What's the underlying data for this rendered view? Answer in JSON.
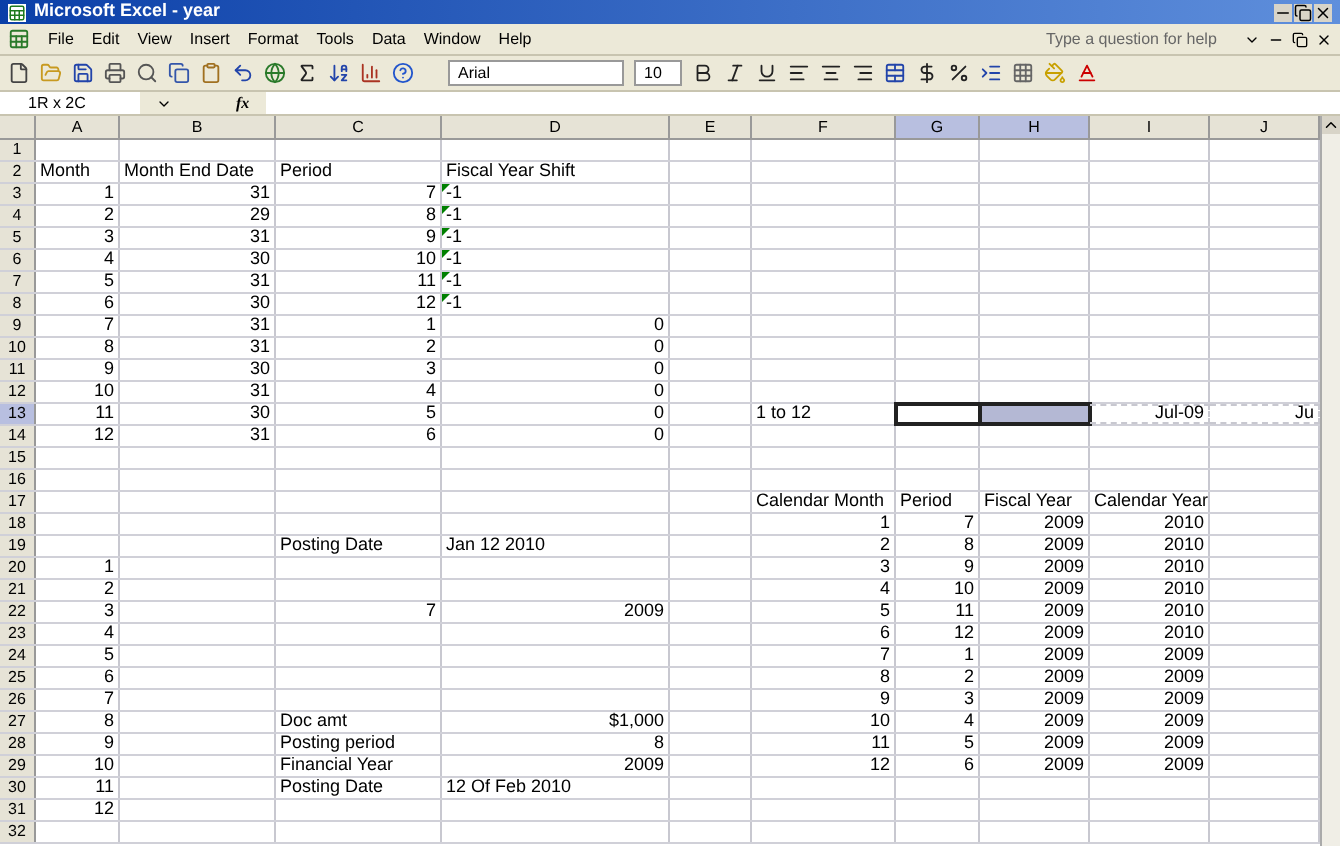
{
  "window": {
    "title": "Microsoft Excel - year"
  },
  "menu": [
    "File",
    "Edit",
    "View",
    "Insert",
    "Format",
    "Tools",
    "Data",
    "Window",
    "Help"
  ],
  "help_box": {
    "placeholder": "Type a question for help"
  },
  "font": {
    "name": "Arial",
    "size": "10"
  },
  "name_box": "1R x 2C",
  "function_label": "fx",
  "columns": [
    {
      "label": "A",
      "selected": false
    },
    {
      "label": "B",
      "selected": false
    },
    {
      "label": "C",
      "selected": false
    },
    {
      "label": "D",
      "selected": false
    },
    {
      "label": "E",
      "selected": false
    },
    {
      "label": "F",
      "selected": false
    },
    {
      "label": "G",
      "selected": true
    },
    {
      "label": "H",
      "selected": true
    },
    {
      "label": "I",
      "selected": false
    },
    {
      "label": "J",
      "selected": false
    }
  ],
  "rows": [
    {
      "number": "1",
      "selected": false,
      "cells": {}
    },
    {
      "number": "2",
      "selected": false,
      "cells": {
        "A": {
          "text": "Month",
          "kind": "text"
        },
        "B": {
          "text": "Month End Date",
          "kind": "text"
        },
        "C": {
          "text": "Period",
          "kind": "text"
        },
        "D": {
          "text": "Fiscal Year Shift",
          "kind": "text"
        }
      }
    },
    {
      "number": "3",
      "selected": false,
      "cells": {
        "A": {
          "text": "1",
          "kind": "number"
        },
        "B": {
          "text": "31",
          "kind": "number"
        },
        "C": {
          "text": "7",
          "kind": "number"
        },
        "D": {
          "text": "-1",
          "kind": "text",
          "flag": true
        }
      }
    },
    {
      "number": "4",
      "selected": false,
      "cells": {
        "A": {
          "text": "2",
          "kind": "number"
        },
        "B": {
          "text": "29",
          "kind": "number"
        },
        "C": {
          "text": "8",
          "kind": "number"
        },
        "D": {
          "text": "-1",
          "kind": "text",
          "flag": true
        }
      }
    },
    {
      "number": "5",
      "selected": false,
      "cells": {
        "A": {
          "text": "3",
          "kind": "number"
        },
        "B": {
          "text": "31",
          "kind": "number"
        },
        "C": {
          "text": "9",
          "kind": "number"
        },
        "D": {
          "text": "-1",
          "kind": "text",
          "flag": true
        }
      }
    },
    {
      "number": "6",
      "selected": false,
      "cells": {
        "A": {
          "text": "4",
          "kind": "number"
        },
        "B": {
          "text": "30",
          "kind": "number"
        },
        "C": {
          "text": "10",
          "kind": "number"
        },
        "D": {
          "text": "-1",
          "kind": "text",
          "flag": true
        }
      }
    },
    {
      "number": "7",
      "selected": false,
      "cells": {
        "A": {
          "text": "5",
          "kind": "number"
        },
        "B": {
          "text": "31",
          "kind": "number"
        },
        "C": {
          "text": "11",
          "kind": "number"
        },
        "D": {
          "text": "-1",
          "kind": "text",
          "flag": true
        }
      }
    },
    {
      "number": "8",
      "selected": false,
      "cells": {
        "A": {
          "text": "6",
          "kind": "number"
        },
        "B": {
          "text": "30",
          "kind": "number"
        },
        "C": {
          "text": "12",
          "kind": "number"
        },
        "D": {
          "text": "-1",
          "kind": "text",
          "flag": true
        }
      }
    },
    {
      "number": "9",
      "selected": false,
      "cells": {
        "A": {
          "text": "7",
          "kind": "number"
        },
        "B": {
          "text": "31",
          "kind": "number"
        },
        "C": {
          "text": "1",
          "kind": "number"
        },
        "D": {
          "text": "0",
          "kind": "number"
        }
      }
    },
    {
      "number": "10",
      "selected": false,
      "cells": {
        "A": {
          "text": "8",
          "kind": "number"
        },
        "B": {
          "text": "31",
          "kind": "number"
        },
        "C": {
          "text": "2",
          "kind": "number"
        },
        "D": {
          "text": "0",
          "kind": "number"
        }
      }
    },
    {
      "number": "11",
      "selected": false,
      "cells": {
        "A": {
          "text": "9",
          "kind": "number"
        },
        "B": {
          "text": "30",
          "kind": "number"
        },
        "C": {
          "text": "3",
          "kind": "number"
        },
        "D": {
          "text": "0",
          "kind": "number"
        }
      }
    },
    {
      "number": "12",
      "selected": false,
      "cells": {
        "A": {
          "text": "10",
          "kind": "number"
        },
        "B": {
          "text": "31",
          "kind": "number"
        },
        "C": {
          "text": "4",
          "kind": "number"
        },
        "D": {
          "text": "0",
          "kind": "number"
        }
      }
    },
    {
      "number": "13",
      "selected": true,
      "cells": {
        "A": {
          "text": "11",
          "kind": "number"
        },
        "B": {
          "text": "30",
          "kind": "number"
        },
        "C": {
          "text": "5",
          "kind": "number"
        },
        "D": {
          "text": "0",
          "kind": "number"
        },
        "F": {
          "text": "1 to 12",
          "kind": "text"
        },
        "G": {
          "active": true
        },
        "H": {
          "in_selection": true
        },
        "I": {
          "text": "Jul-09",
          "kind": "number",
          "copy_marquee": true
        },
        "J": {
          "text": "Ju",
          "kind": "number",
          "copy_marquee": true
        }
      }
    },
    {
      "number": "14",
      "selected": false,
      "cells": {
        "A": {
          "text": "12",
          "kind": "number"
        },
        "B": {
          "text": "31",
          "kind": "number"
        },
        "C": {
          "text": "6",
          "kind": "number"
        },
        "D": {
          "text": "0",
          "kind": "number"
        }
      }
    },
    {
      "number": "15",
      "selected": false,
      "cells": {}
    },
    {
      "number": "16",
      "selected": false,
      "cells": {}
    },
    {
      "number": "17",
      "selected": false,
      "cells": {
        "F": {
          "text": "Calendar Month",
          "kind": "text"
        },
        "G": {
          "text": "Period",
          "kind": "text"
        },
        "H": {
          "text": "Fiscal Year",
          "kind": "text"
        },
        "I": {
          "text": "Calendar Year",
          "kind": "text"
        }
      }
    },
    {
      "number": "18",
      "selected": false,
      "cells": {
        "F": {
          "text": "1",
          "kind": "number"
        },
        "G": {
          "text": "7",
          "kind": "number"
        },
        "H": {
          "text": "2009",
          "kind": "number"
        },
        "I": {
          "text": "2010",
          "kind": "number"
        }
      }
    },
    {
      "number": "19",
      "selected": false,
      "cells": {
        "C": {
          "text": "Posting Date",
          "kind": "text"
        },
        "D": {
          "text": "Jan 12 2010",
          "kind": "text"
        },
        "F": {
          "text": "2",
          "kind": "number"
        },
        "G": {
          "text": "8",
          "kind": "number"
        },
        "H": {
          "text": "2009",
          "kind": "number"
        },
        "I": {
          "text": "2010",
          "kind": "number"
        }
      }
    },
    {
      "number": "20",
      "selected": false,
      "cells": {
        "A": {
          "text": "1",
          "kind": "number"
        },
        "F": {
          "text": "3",
          "kind": "number"
        },
        "G": {
          "text": "9",
          "kind": "number"
        },
        "H": {
          "text": "2009",
          "kind": "number"
        },
        "I": {
          "text": "2010",
          "kind": "number"
        }
      }
    },
    {
      "number": "21",
      "selected": false,
      "cells": {
        "A": {
          "text": "2",
          "kind": "number"
        },
        "F": {
          "text": "4",
          "kind": "number"
        },
        "G": {
          "text": "10",
          "kind": "number"
        },
        "H": {
          "text": "2009",
          "kind": "number"
        },
        "I": {
          "text": "2010",
          "kind": "number"
        }
      }
    },
    {
      "number": "22",
      "selected": false,
      "cells": {
        "A": {
          "text": "3",
          "kind": "number"
        },
        "C": {
          "text": "7",
          "kind": "number"
        },
        "D": {
          "text": "2009",
          "kind": "number"
        },
        "F": {
          "text": "5",
          "kind": "number"
        },
        "G": {
          "text": "11",
          "kind": "number"
        },
        "H": {
          "text": "2009",
          "kind": "number"
        },
        "I": {
          "text": "2010",
          "kind": "number"
        }
      }
    },
    {
      "number": "23",
      "selected": false,
      "cells": {
        "A": {
          "text": "4",
          "kind": "number"
        },
        "F": {
          "text": "6",
          "kind": "number"
        },
        "G": {
          "text": "12",
          "kind": "number"
        },
        "H": {
          "text": "2009",
          "kind": "number"
        },
        "I": {
          "text": "2010",
          "kind": "number"
        }
      }
    },
    {
      "number": "24",
      "selected": false,
      "cells": {
        "A": {
          "text": "5",
          "kind": "number"
        },
        "F": {
          "text": "7",
          "kind": "number"
        },
        "G": {
          "text": "1",
          "kind": "number"
        },
        "H": {
          "text": "2009",
          "kind": "number"
        },
        "I": {
          "text": "2009",
          "kind": "number"
        }
      }
    },
    {
      "number": "25",
      "selected": false,
      "cells": {
        "A": {
          "text": "6",
          "kind": "number"
        },
        "F": {
          "text": "8",
          "kind": "number"
        },
        "G": {
          "text": "2",
          "kind": "number"
        },
        "H": {
          "text": "2009",
          "kind": "number"
        },
        "I": {
          "text": "2009",
          "kind": "number"
        }
      }
    },
    {
      "number": "26",
      "selected": false,
      "cells": {
        "A": {
          "text": "7",
          "kind": "number"
        },
        "F": {
          "text": "9",
          "kind": "number"
        },
        "G": {
          "text": "3",
          "kind": "number"
        },
        "H": {
          "text": "2009",
          "kind": "number"
        },
        "I": {
          "text": "2009",
          "kind": "number"
        }
      }
    },
    {
      "number": "27",
      "selected": false,
      "cells": {
        "A": {
          "text": "8",
          "kind": "number"
        },
        "C": {
          "text": "Doc amt",
          "kind": "text"
        },
        "D": {
          "text": "$1,000",
          "kind": "number"
        },
        "F": {
          "text": "10",
          "kind": "number"
        },
        "G": {
          "text": "4",
          "kind": "number"
        },
        "H": {
          "text": "2009",
          "kind": "number"
        },
        "I": {
          "text": "2009",
          "kind": "number"
        }
      }
    },
    {
      "number": "28",
      "selected": false,
      "cells": {
        "A": {
          "text": "9",
          "kind": "number"
        },
        "C": {
          "text": "Posting period",
          "kind": "text"
        },
        "D": {
          "text": "8",
          "kind": "number"
        },
        "F": {
          "text": "11",
          "kind": "number"
        },
        "G": {
          "text": "5",
          "kind": "number"
        },
        "H": {
          "text": "2009",
          "kind": "number"
        },
        "I": {
          "text": "2009",
          "kind": "number"
        }
      }
    },
    {
      "number": "29",
      "selected": false,
      "cells": {
        "A": {
          "text": "10",
          "kind": "number"
        },
        "C": {
          "text": "Financial Year",
          "kind": "text"
        },
        "D": {
          "text": "2009",
          "kind": "number"
        },
        "F": {
          "text": "12",
          "kind": "number"
        },
        "G": {
          "text": "6",
          "kind": "number"
        },
        "H": {
          "text": "2009",
          "kind": "number"
        },
        "I": {
          "text": "2009",
          "kind": "number"
        }
      }
    },
    {
      "number": "30",
      "selected": false,
      "cells": {
        "A": {
          "text": "11",
          "kind": "number"
        },
        "C": {
          "text": "Posting Date",
          "kind": "text"
        },
        "D": {
          "text": "12 Of Feb 2010",
          "kind": "text"
        }
      }
    },
    {
      "number": "31",
      "selected": false,
      "cells": {
        "A": {
          "text": "12",
          "kind": "number"
        }
      }
    },
    {
      "number": "32",
      "selected": false,
      "cells": {}
    }
  ]
}
